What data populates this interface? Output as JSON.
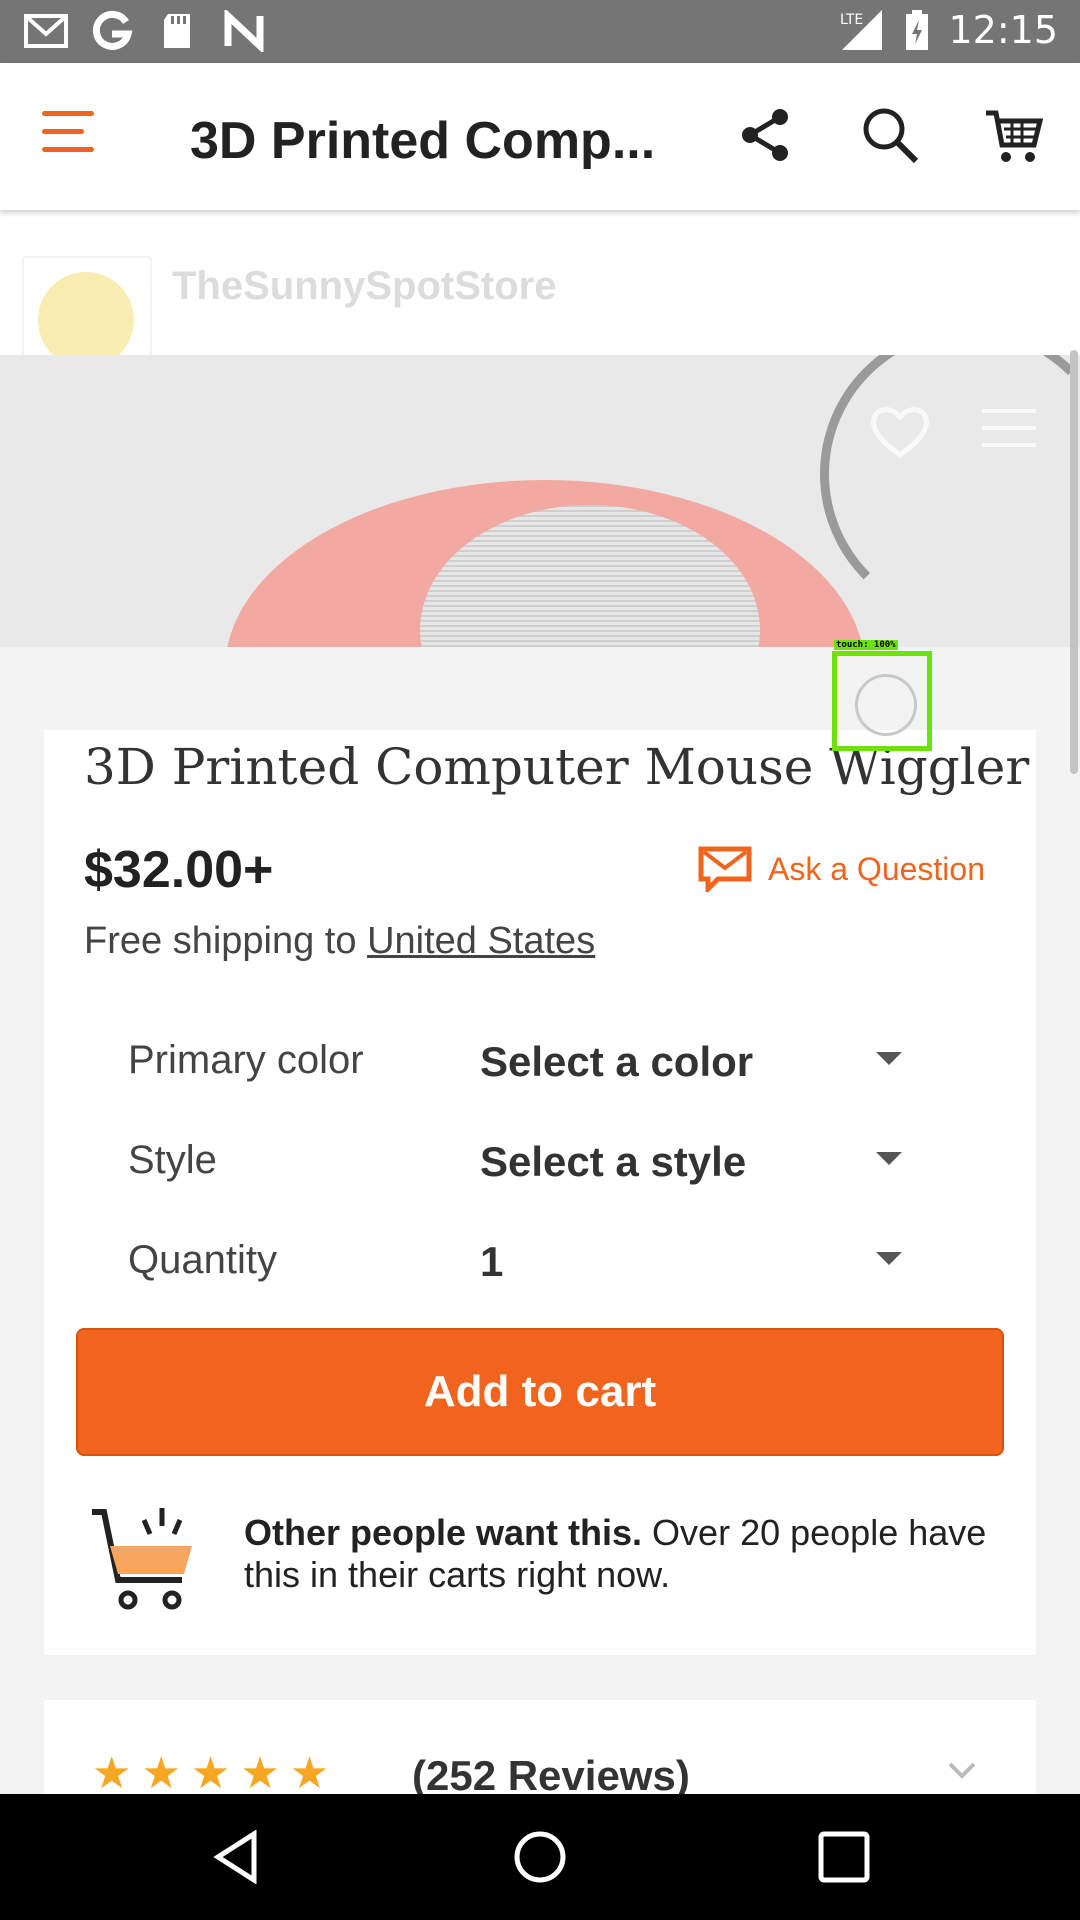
{
  "status_bar": {
    "time": "12:15",
    "network": "LTE",
    "left_icons": [
      "gmail-icon",
      "google-icon",
      "sd-card-icon",
      "n-icon"
    ]
  },
  "app_bar": {
    "title": "3D Printed Comp...",
    "icons": [
      "menu-icon",
      "share-icon",
      "search-icon",
      "cart-icon"
    ]
  },
  "store": {
    "name": "TheSunnySpotStore"
  },
  "product": {
    "title": "3D Printed Computer Mouse Wiggler",
    "price": "$32.00+",
    "ask_question": "Ask a Question",
    "shipping_prefix": "Free shipping to ",
    "shipping_country": "United States"
  },
  "options": [
    {
      "label": "Primary color",
      "value": "Select a color"
    },
    {
      "label": "Style",
      "value": "Select a style"
    },
    {
      "label": "Quantity",
      "value": "1"
    }
  ],
  "add_to_cart_label": "Add to cart",
  "demand": {
    "headline": "Other people want this.",
    "body": " Over 20 people have this in their carts right now."
  },
  "reviews": {
    "rating": 5,
    "stars_text": "★★★★★",
    "count_label": "(252 Reviews)"
  },
  "touch_overlay": {
    "label": "touch: 100%"
  },
  "colors": {
    "accent": "#f1641e",
    "star": "#f5a623",
    "touch_box": "#6ee20f"
  }
}
